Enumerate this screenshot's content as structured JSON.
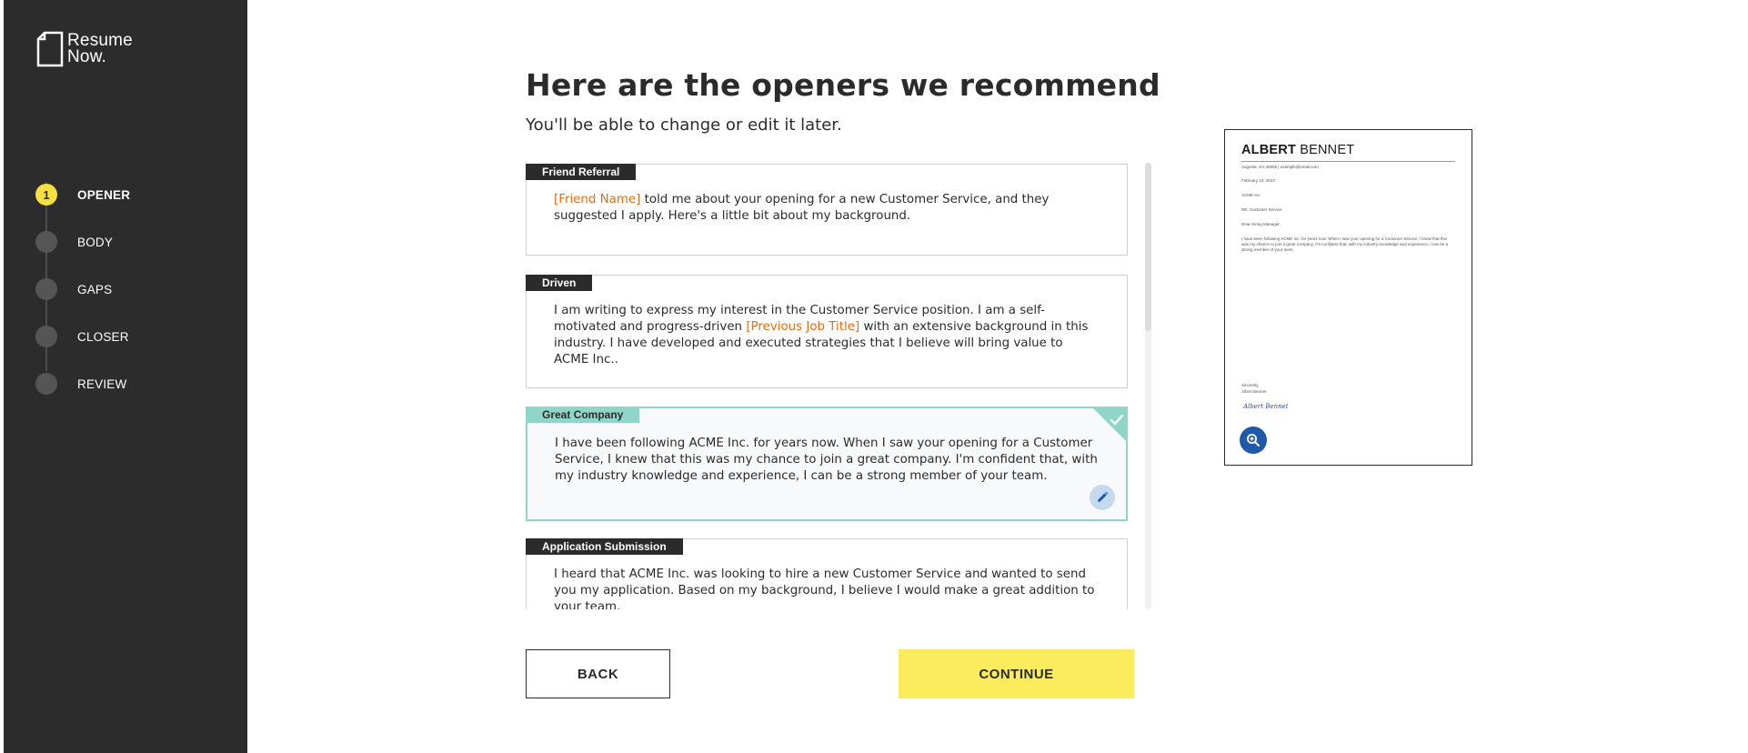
{
  "brand": {
    "logo_line1": "Resume",
    "logo_line2": "Now."
  },
  "steps": [
    {
      "number": "1",
      "label": "OPENER",
      "active": true
    },
    {
      "number": "",
      "label": "BODY",
      "active": false
    },
    {
      "number": "",
      "label": "GAPS",
      "active": false
    },
    {
      "number": "",
      "label": "CLOSER",
      "active": false
    },
    {
      "number": "",
      "label": "REVIEW",
      "active": false
    }
  ],
  "main": {
    "title": "Here are the openers we recommend",
    "subtitle": "You'll be able to change or edit it later."
  },
  "openers": [
    {
      "tag": "Friend Referral",
      "placeholder": "[Friend Name]",
      "text": " told me about your opening for a new Customer Service, and they suggested I apply. Here's a little bit about my background."
    },
    {
      "tag": "Driven",
      "text_before": "I am writing to express my interest in the Customer Service position. I am a self-motivated and progress-driven ",
      "placeholder": "[Previous Job Title]",
      "text_after": " with an extensive background in this industry. I have developed and executed strategies that I believe will bring value to ACME Inc.."
    },
    {
      "tag": "Great Company",
      "selected": true,
      "text": "I have been following ACME Inc. for years now. When I saw your opening for a Customer Service, I knew that this was my chance to join a great company. I'm confident that, with my industry knowledge and experience, I can be a strong member of your team."
    },
    {
      "tag": "Application Submission",
      "text": "I heard that ACME Inc. was looking to hire a new Customer Service and wanted to send you my application. Based on my background, I believe I would make a great addition to your team."
    }
  ],
  "buttons": {
    "back": "BACK",
    "continue": "CONTINUE"
  },
  "preview": {
    "first_name": "ALBERT",
    "last_name": "BENNET",
    "contact": "Augusta, GA 30906 | example@email.com",
    "date": "February 13, 2023",
    "company": "ACME Inc.",
    "re": "RE: Customer Service",
    "salutation": "Dear Hiring Manager,",
    "body": "I have been following ACME Inc. for years now. When I saw your opening for a Customer Service, I knew that this was my chance to join a great company. I'm confident that, with my industry knowledge and experience, I can be a strong member of your team.",
    "closing": "Sincerely,",
    "signer": "Albert Bennet",
    "signature": "Albert Bennet"
  },
  "colors": {
    "sidebar": "#2c2c2c",
    "accent_yellow": "#faec5d",
    "selected_border": "#8fd6c8",
    "placeholder_orange": "#e66b14",
    "zoom_blue": "#1e5aa8"
  },
  "icons": [
    "document-logo-icon",
    "check-icon",
    "pencil-icon",
    "zoom-in-icon"
  ]
}
